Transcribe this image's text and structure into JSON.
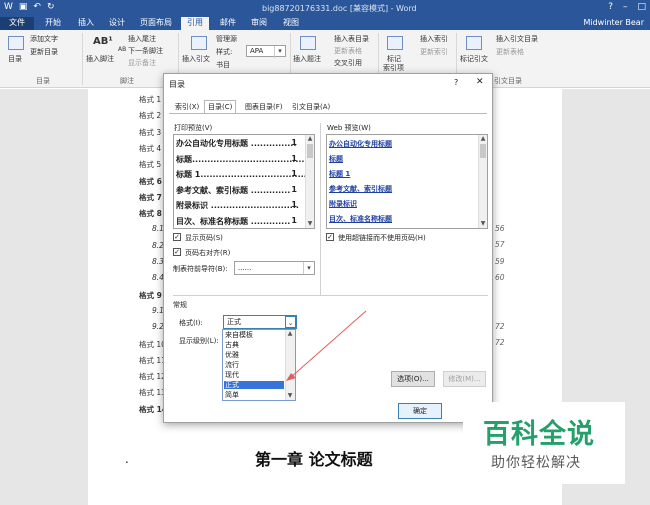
{
  "window": {
    "doc_title": "big88720176331.doc [兼容模式] - Word",
    "user": "Midwinter Bear"
  },
  "ribbon": {
    "tabs": [
      "文件",
      "开始",
      "插入",
      "设计",
      "页面布局",
      "引用",
      "邮件",
      "审阅",
      "视图"
    ],
    "selected_tab": "引用",
    "groups": {
      "toc": {
        "label": "目录",
        "btn_toc": "目录",
        "btn_add_text": "添加文字",
        "btn_update": "更新目录"
      },
      "footnote": {
        "label": "脚注",
        "btn_insert_footnote": "插入脚注",
        "btn_insert_endnote": "插入尾注",
        "btn_next_footnote": "下一条脚注",
        "btn_show_notes": "显示备注",
        "icon_text": "AB¹",
        "small_icon_text": "AB"
      },
      "citations": {
        "btn_insert_citation": "插入引文",
        "btn_manage_sources": "管理源",
        "style_label": "样式:",
        "style_value": "APA",
        "btn_bibliography": "书目"
      },
      "captions": {
        "btn_insert_caption": "插入题注",
        "btn_insert_table_figures": "插入表目录",
        "btn_update_table": "更新表格",
        "btn_cross_ref": "交叉引用"
      },
      "index": {
        "btn_mark_entry": "标记\n索引项",
        "btn_mark_entry_l1": "标记",
        "btn_mark_entry_l2": "索引项",
        "btn_insert_index": "插入索引",
        "btn_update_index": "更新索引"
      },
      "toa": {
        "label": "引文目录",
        "btn_mark_citation": "标记引文",
        "btn_insert_toa": "插入引文目录",
        "btn_update_table": "更新表格"
      }
    }
  },
  "document": {
    "toc_lines": [
      {
        "text": "格式 1",
        "style": "n"
      },
      {
        "text": "格式 2",
        "style": "n"
      },
      {
        "text": "格式 3",
        "style": "n"
      },
      {
        "text": "格式 4",
        "style": "n"
      },
      {
        "text": "格式 5",
        "style": "n"
      },
      {
        "text": "格式 6",
        "style": "b"
      },
      {
        "text": "格式 7",
        "style": "b"
      },
      {
        "text": "格式 8",
        "style": "b"
      },
      {
        "text": "8.1",
        "style": "i"
      },
      {
        "text": "8.2",
        "style": "i"
      },
      {
        "text": "8.3",
        "style": "i"
      },
      {
        "text": "8.4",
        "style": "i"
      },
      {
        "text": "格式 9",
        "style": "b"
      },
      {
        "text": "9.1",
        "style": "i"
      },
      {
        "text": "9.2",
        "style": "i"
      },
      {
        "text": "格式 10",
        "style": "n"
      },
      {
        "text": "格式 11",
        "style": "n"
      },
      {
        "text": "格式 12",
        "style": "n"
      },
      {
        "text": "格式 13",
        "style": "n"
      },
      {
        "text": "格式 14",
        "style": "b"
      }
    ],
    "right_numbers": [
      "56",
      "57",
      "59",
      "60",
      "72",
      "72"
    ],
    "chapter_heading": "第一章  论文标题",
    "bullet": "."
  },
  "dialog": {
    "title": "目录",
    "help": "?",
    "close": "✕",
    "tabs": [
      "索引(X)",
      "目录(C)",
      "图表目录(F)",
      "引文目录(A)"
    ],
    "selected_tab": "目录(C)",
    "print_preview": {
      "label": "打印预览(V)",
      "items": [
        {
          "text": "办公自动化专用标题 ...............",
          "page": "1"
        },
        {
          "text": "标题...........................................",
          "page": "1"
        },
        {
          "text": "标题  1.....................................",
          "page": "1"
        },
        {
          "text": "参考文献、索引标题 .............",
          "page": "1"
        },
        {
          "text": "附录标识 .............................",
          "page": "1"
        },
        {
          "text": "目次、标准名称标题 .............",
          "page": "1"
        }
      ]
    },
    "web_preview": {
      "label": "Web 预览(W)",
      "items": [
        "办公自动化专用标题",
        "标题",
        "标题  1",
        "参考文献、索引标题",
        "附录标识",
        "目次、标准名称标题"
      ]
    },
    "show_page_numbers": {
      "label": "显示页码(S)",
      "checked": true
    },
    "right_align": {
      "label": "页码右对齐(R)",
      "checked": true
    },
    "tab_leader": {
      "label": "制表符前导符(B):",
      "value": "......"
    },
    "use_hyperlinks": {
      "label": "使用超链接而不使用页码(H)",
      "checked": true
    },
    "general": {
      "label": "常规",
      "format_label": "格式(I):",
      "format_value": "正式",
      "levels_label": "显示级别(L):"
    },
    "format_options": [
      "来自模板",
      "古典",
      "优雅",
      "流行",
      "现代",
      "正式",
      "简单"
    ],
    "selected_format": "正式",
    "btn_options": "选项(O)...",
    "btn_modify": "修改(M)...",
    "btn_ok": "确定",
    "check_mark": "✓"
  },
  "watermark": {
    "big": "百科全说",
    "small": "助你轻松解决"
  },
  "colors": {
    "word_blue": "#2b579a",
    "arrow": "#e35d5d",
    "selection": "#3874d8",
    "watermark_green": "#25a06b"
  }
}
